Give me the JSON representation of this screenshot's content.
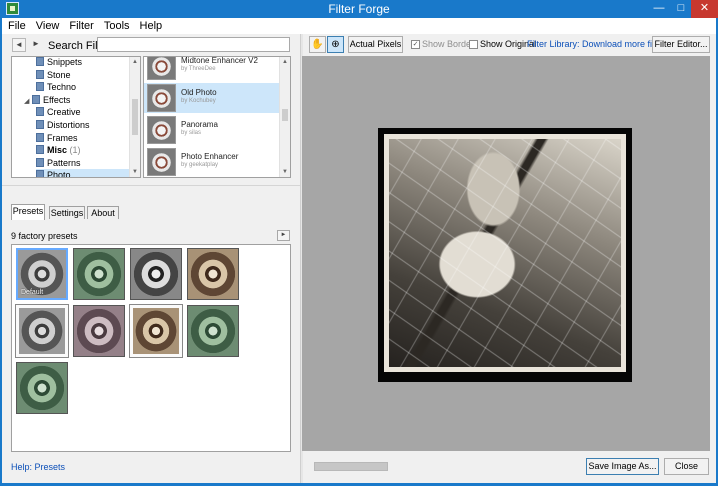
{
  "window": {
    "title": "Filter Forge",
    "minimize": "—",
    "maximize": "□",
    "close": "✕"
  },
  "menu": [
    "File",
    "View",
    "Filter",
    "Tools",
    "Help"
  ],
  "search": {
    "label": "Search Filters:",
    "value": "",
    "back": "◄",
    "forward": "►"
  },
  "tree": {
    "items": [
      {
        "label": "Snippets",
        "indent": 1
      },
      {
        "label": "Stone",
        "indent": 1
      },
      {
        "label": "Techno",
        "indent": 1
      },
      {
        "label": "Effects",
        "indent": 0,
        "expander": "◢"
      },
      {
        "label": "Creative",
        "indent": 1
      },
      {
        "label": "Distortions",
        "indent": 1
      },
      {
        "label": "Frames",
        "indent": 1
      },
      {
        "label": "Misc",
        "indent": 1,
        "bold": true,
        "count": "(1)"
      },
      {
        "label": "Patterns",
        "indent": 1
      },
      {
        "label": "Photo",
        "indent": 1,
        "selected": true
      }
    ]
  },
  "filters": {
    "items": [
      {
        "name": "Midtone Enhancer V2",
        "author": "by ThreeDee"
      },
      {
        "name": "Old Photo",
        "author": "by Kochubey",
        "selected": true
      },
      {
        "name": "Panorama",
        "author": "by silas"
      },
      {
        "name": "Photo Enhancer",
        "author": "by geekatplay"
      }
    ]
  },
  "tabs": [
    {
      "label": "Presets",
      "active": true
    },
    {
      "label": "Settings"
    },
    {
      "label": "About"
    }
  ],
  "presets": {
    "count_label": "9 factory presets",
    "arrow": "►",
    "default_label": "Default",
    "items": [
      {
        "style": "p-gray",
        "selected": true
      },
      {
        "style": "p-green"
      },
      {
        "style": "p-bw"
      },
      {
        "style": "p-sepia"
      },
      {
        "style": "p-gray p-white"
      },
      {
        "style": "p-mauve"
      },
      {
        "style": "p-sepia p-white"
      },
      {
        "style": "p-green"
      },
      {
        "style": "p-green"
      }
    ]
  },
  "help_link": "Help: Presets",
  "toolbar": {
    "hand_icon": "✋",
    "zoom_icon": "⊕",
    "actual_pixels": "Actual Pixels",
    "show_border": "Show Border",
    "show_border_checked": "✓",
    "show_original": "Show Original",
    "library_link": "Filter Library: Download more filters",
    "filter_editor": "Filter Editor..."
  },
  "progress": {
    "value": 0.0
  },
  "buttons": {
    "save": "Save Image As...",
    "close": "Close"
  }
}
